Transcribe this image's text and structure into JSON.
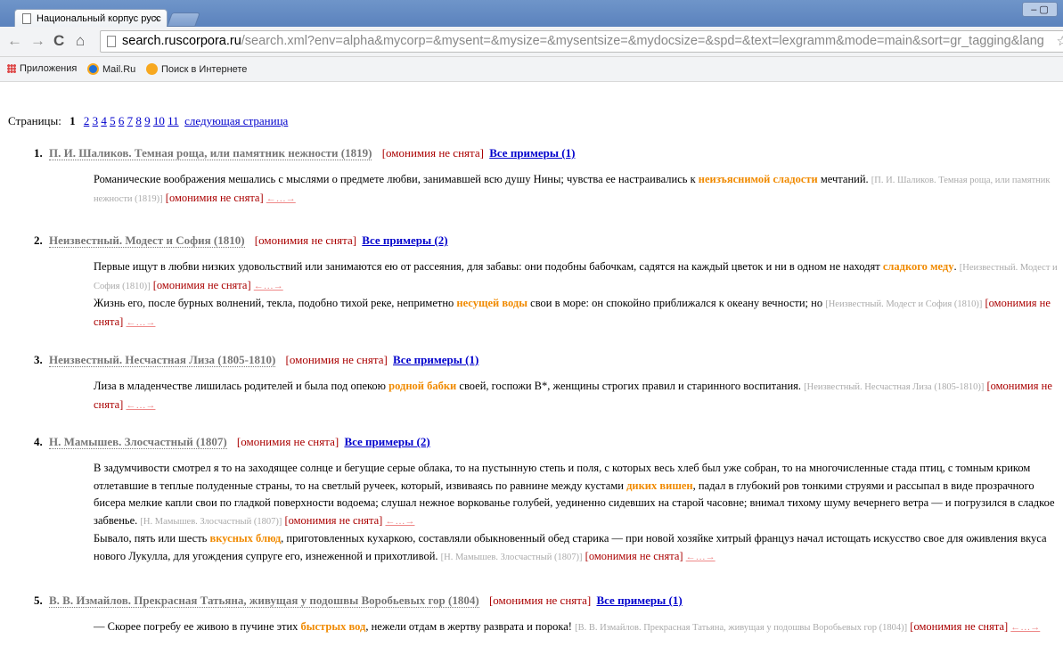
{
  "browser": {
    "tab_title": "Национальный корпус русс",
    "tab_close": "×",
    "window_controls": "–  ▢",
    "url_host": "search.ruscorpora.ru",
    "url_path": "/search.xml?env=alpha&mycorp=&mysent=&mysize=&mysentsize=&mydocsize=&spd=&text=lexgramm&mode=main&sort=gr_tagging&lang",
    "bookmarks": [
      "Приложения",
      "Mail.Ru",
      "Поиск в Интернете"
    ]
  },
  "pager": {
    "label": "Страницы:",
    "current": "1",
    "pages": [
      "2",
      "3",
      "4",
      "5",
      "6",
      "7",
      "8",
      "9",
      "10",
      "11"
    ],
    "next": "следующая страница"
  },
  "common": {
    "homonymy": "[омонимия не снята]",
    "arrows": "←…→"
  },
  "docs": [
    {
      "num": "1.",
      "title": "П. И. Шаликов. Темная роща, или памятник нежности (1819)",
      "all": "Все примеры (1)",
      "snippets": [
        {
          "pre": "Романические воображения мешались с мыслями о предмете любви, занимавшей всю душу Нины; чувства ее настраивались к ",
          "hl": "неизъяснимой сладости",
          "post": " мечтаний. ",
          "src": "[П. И. Шаликов. Темная роща, или памятник нежности (1819)]"
        }
      ]
    },
    {
      "num": "2.",
      "title": "Неизвестный. Модест и София (1810)",
      "all": "Все примеры (2)",
      "snippets": [
        {
          "pre": "Первые ищут в любви низких удовольствий или занимаются ею от рассеяния, для забавы: они подобны бабочкам, садятся на каждый цветок и ни в одном не находят ",
          "hl": "сладкого меду",
          "post": ". ",
          "src": "[Неизвестный. Модест и София (1810)]"
        },
        {
          "pre": "Жизнь его, после бурных волнений, текла, подобно тихой реке, неприметно ",
          "hl": "несущей воды",
          "post": " свои в море: он спокойно приближался к океану вечности; но ",
          "src": "[Неизвестный. Модест и София (1810)]"
        }
      ]
    },
    {
      "num": "3.",
      "title": "Неизвестный. Несчастная Лиза (1805-1810)",
      "all": "Все примеры (1)",
      "snippets": [
        {
          "pre": "Лиза в младенчестве лишилась родителей и была под опекою ",
          "hl": "родной бабки",
          "post": " своей, госпожи В*, женщины строгих правил и старинного воспитания. ",
          "src": "[Неизвестный. Несчастная Лиза (1805-1810)]"
        }
      ]
    },
    {
      "num": "4.",
      "title": "Н. Мамышев. Злосчастный (1807)",
      "all": "Все примеры (2)",
      "snippets": [
        {
          "pre": "В задумчивости смотрел я то на заходящее солнце и бегущие серые облака, то на пустынную степь и поля, с которых весь хлеб был уже собран, то на многочисленные стада птиц, с томным криком отлетавшие в теплые полуденные страны, то на светлый ручеек, который, извиваясь по равнине между кустами ",
          "hl": "диких вишен",
          "post": ", падал в глубокий ров тонкими струями и рассыпал в виде прозрачного бисера мелкие капли свои по гладкой поверхности водоема; слушал нежное воркованье голубей, уединенно сидевших на старой часовне; внимал тихому шуму вечернего ветра — и погрузился в сладкое забвенье. ",
          "src": "[Н. Мамышев. Злосчастный (1807)]"
        },
        {
          "pre": "Бывало, пять или шесть ",
          "hl": "вкусных блюд",
          "post": ", приготовленных кухаркою, составляли обыкновенный обед старика — при новой хозяйке хитрый француз начал истощать искусство свое для оживления вкуса нового Лукулла, для угождения супруге его, изнеженной и прихотливой. ",
          "src": "[Н. Мамышев. Злосчастный (1807)]"
        }
      ]
    },
    {
      "num": "5.",
      "title": "В. В. Измайлов. Прекрасная Татьяна, живущая у подошвы Воробьевых гор (1804)",
      "all": "Все примеры (1)",
      "snippets": [
        {
          "pre": "— Скорее погребу ее живою в пучине этих ",
          "hl": "быстрых вод",
          "post": ", нежели отдам в жертву разврата и порока! ",
          "src": "[В. В. Измайлов. Прекрасная Татьяна, живущая у подошвы Воробьевых гор (1804)]"
        }
      ]
    }
  ]
}
